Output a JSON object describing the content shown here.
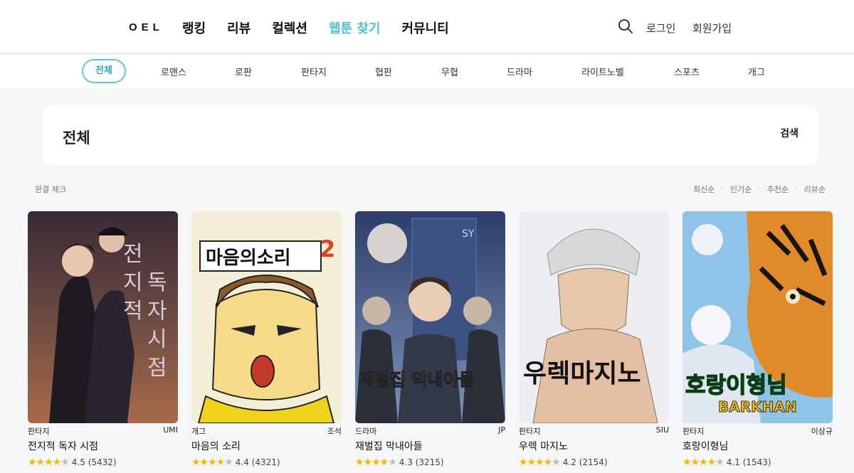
{
  "header": {
    "logo": "OEL",
    "nav": [
      "랭킹",
      "리뷰",
      "컬렉션",
      "웹툰 찾기",
      "커뮤니티"
    ],
    "active_nav": "웹툰 찾기",
    "search_icon": "search-icon",
    "login": "로그인",
    "signup": "회원가입"
  },
  "genres": {
    "items": [
      "전체",
      "로맨스",
      "로판",
      "판타지",
      "협판",
      "무협",
      "드라마",
      "라이트노벨",
      "스포츠",
      "개그"
    ],
    "active": "전체"
  },
  "main": {
    "title": "전체",
    "search_label": "검색",
    "complete_check": "완결 체크",
    "sorts": [
      "최신순",
      "인기순",
      "추천순",
      "리뷰순"
    ]
  },
  "colors": {
    "accent": "#5ec8d8",
    "active_nav": "#4fc3d6",
    "star": "#f5b800"
  },
  "webtoons": [
    {
      "genre": "판타지",
      "author": "UMI",
      "title": "전지적 독자 시점",
      "rating": "4.5",
      "reviews": "(5432)",
      "stars_value": 4.5,
      "cover_text": [
        "전",
        "지",
        "적",
        "독",
        "자",
        "시",
        "점"
      ]
    },
    {
      "genre": "개그",
      "author": "조석",
      "title": "마음의 소리",
      "rating": "4.4",
      "reviews": "(4321)",
      "stars_value": 4.4,
      "cover_text": [
        "마음의소리",
        "2"
      ]
    },
    {
      "genre": "드라마",
      "author": "JP",
      "title": "재벌집 막내아들",
      "rating": "4.3",
      "reviews": "(3215)",
      "stars_value": 4.3,
      "cover_text": [
        "재벌집 막내아들",
        "SY"
      ]
    },
    {
      "genre": "판타지",
      "author": "SIU",
      "title": "우렉 마지노",
      "rating": "4.2",
      "reviews": "(2154)",
      "stars_value": 4.2,
      "cover_text": [
        "우렉마지노"
      ]
    },
    {
      "genre": "판타지",
      "author": "이상규",
      "title": "호랑이형님",
      "rating": "4.1",
      "reviews": "(1543)",
      "stars_value": 4.1,
      "cover_text": [
        "호랑이형님",
        "BARKHAN"
      ]
    }
  ]
}
